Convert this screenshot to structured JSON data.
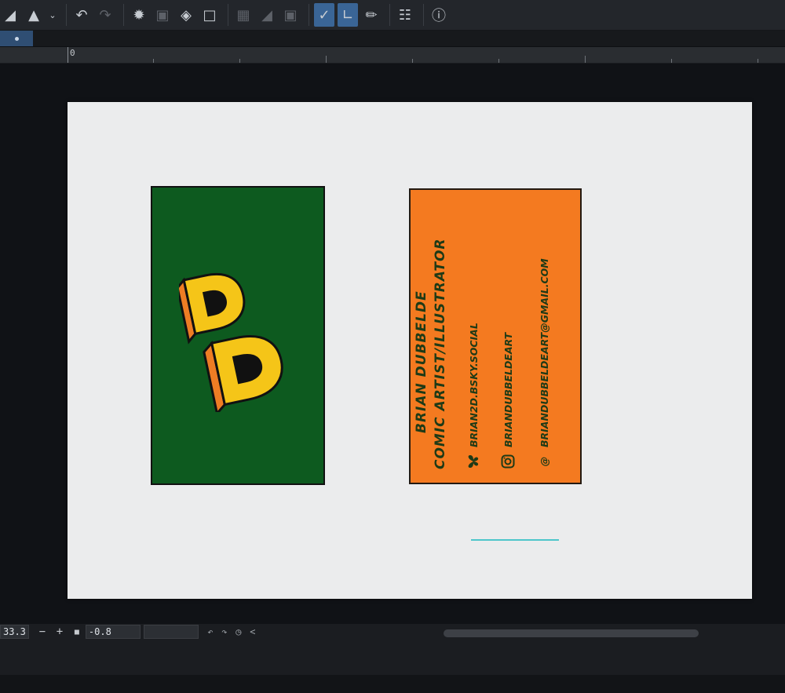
{
  "toolbar": {
    "icons": [
      "fill-tool-icon",
      "save-icon",
      "dropdown-icon",
      "undo-icon",
      "redo-icon",
      "loading-icon",
      "select-icon",
      "fill-icon",
      "transform-icon",
      "grid-icon",
      "gradient-icon",
      "frame-icon",
      "correction-line-icon",
      "vector-line-icon",
      "pen-icon",
      "layout-icon",
      "help-icon"
    ]
  },
  "ruler": {
    "origin_label": "0"
  },
  "card_back": {
    "name": "BRIAN DUBBELDE",
    "title": "COMIC ARTIST/ILLUSTRATOR",
    "bluesky": "BRIAN2D.BSKY.SOCIAL",
    "instagram": "BRIANDUBBELDEART",
    "email": "BRIANDUBBELDEART@GMAIL.COM",
    "email_symbol": "@"
  },
  "statusbar": {
    "zoom": "33.3",
    "minus": "−",
    "plus": "+",
    "angle": "-0.8",
    "collapse": "<"
  },
  "colors": {
    "front_card": "#0d5a1f",
    "back_card": "#f47a20",
    "logo_yellow": "#f5c518",
    "logo_orange": "#ee7d24",
    "accent_line": "#4ec6cb",
    "active_tool": "#3a6596"
  }
}
